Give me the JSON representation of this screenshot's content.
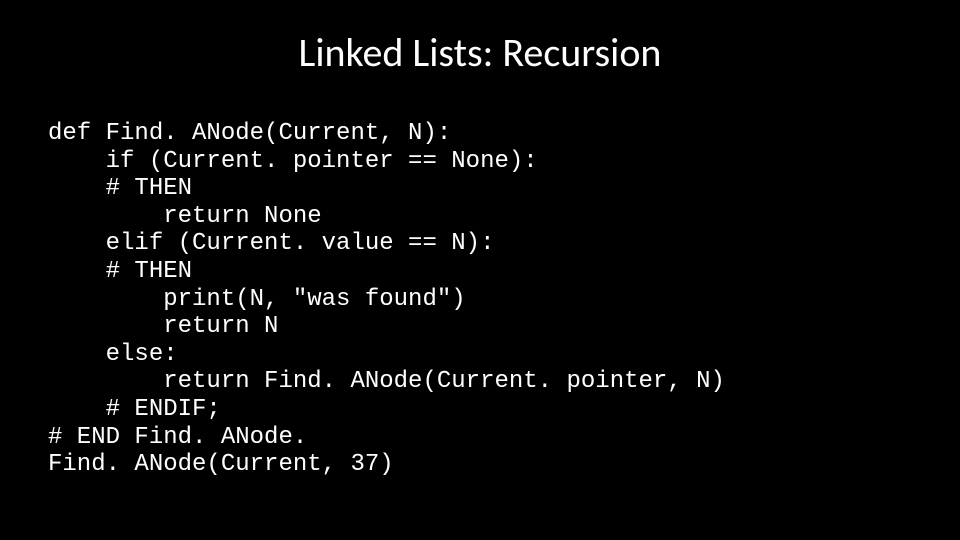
{
  "slide": {
    "title": "Linked Lists: Recursion",
    "code": "def Find. ANode(Current, N):\n    if (Current. pointer == None):\n    # THEN\n        return None\n    elif (Current. value == N):\n    # THEN\n        print(N, \"was found\")\n        return N\n    else:\n        return Find. ANode(Current. pointer, N)\n    # ENDIF;\n# END Find. ANode.\nFind. ANode(Current, 37)"
  }
}
